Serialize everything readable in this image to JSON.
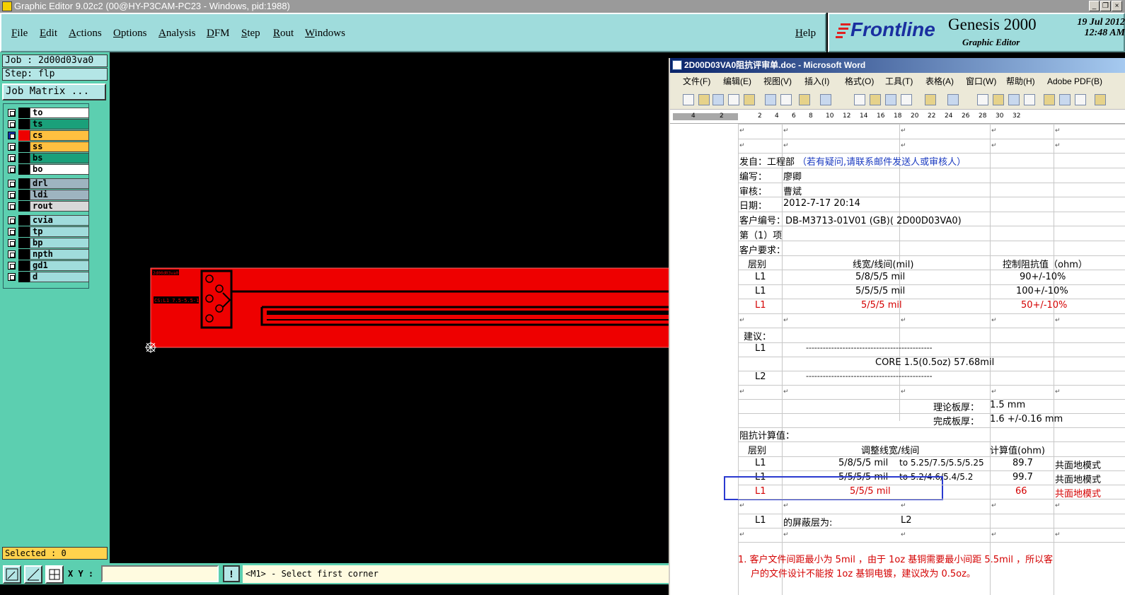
{
  "window": {
    "title": "Graphic Editor 9.02c2 (00@HY-P3CAM-PC23 - Windows, pid:1988)",
    "controls": [
      "_",
      "❐",
      "×"
    ]
  },
  "menu": {
    "items": [
      "File",
      "Edit",
      "Actions",
      "Options",
      "Analysis",
      "DFM",
      "Step",
      "Rout",
      "Windows"
    ],
    "help": "Help"
  },
  "brand": {
    "logo": "Frontline",
    "product": "Genesis 2000",
    "subtitle": "Graphic Editor",
    "date": "19 Jul 2012",
    "time": "12:48 AM"
  },
  "job": {
    "job": "Job : 2d00d03va0",
    "step": "Step: flp",
    "matrix_button": "Job Matrix ..."
  },
  "layers": [
    {
      "name": "to",
      "color": "#ffffff"
    },
    {
      "name": "ts",
      "color": "#1aa07a"
    },
    {
      "name": "cs",
      "color": "#ffc040",
      "active": true
    },
    {
      "name": "ss",
      "color": "#ffc040"
    },
    {
      "name": "bs",
      "color": "#1aa07a"
    },
    {
      "name": "bo",
      "color": "#ffffff"
    },
    {
      "name": "drl",
      "color": "#9eb4c0"
    },
    {
      "name": "ldi",
      "color": "#9eb4c0"
    },
    {
      "name": "rout",
      "color": "#d8d8d8"
    },
    {
      "name": "cvia",
      "color": "#a0dcdc"
    },
    {
      "name": "tp",
      "color": "#a0dcdc"
    },
    {
      "name": "bp",
      "color": "#a0dcdc"
    },
    {
      "name": "npth",
      "color": "#a0dcdc"
    },
    {
      "name": "gd1",
      "color": "#a0dcdc"
    },
    {
      "name": "d",
      "color": "#a0dcdc"
    }
  ],
  "selected": "Selected : 0",
  "xy_label": "X Y :",
  "warn": "!",
  "status": "<M1> - Select first corner",
  "board": {
    "label1": "2d00d03va0",
    "label2": "CS:L1 7.5-5.5-1.15"
  },
  "word": {
    "title": "2D00D03VA0阻抗评审单.doc - Microsoft Word",
    "menu": [
      "文件(F)",
      "编辑(E)",
      "视图(V)",
      "插入(I)",
      "格式(O)",
      "工具(T)",
      "表格(A)",
      "窗口(W)",
      "帮助(H)",
      "Adobe PDF(B)"
    ],
    "ruler": [
      "4",
      "2",
      "2",
      "4",
      "6",
      "8",
      "10",
      "12",
      "14",
      "16",
      "18",
      "20",
      "22",
      "24",
      "26",
      "28",
      "30",
      "32"
    ],
    "lines": {
      "from_label": "发自：工程部",
      "from_note": "（若有疑问,请联系邮件发送人或审核人）",
      "writer_label": "编写：",
      "writer": "廖卿",
      "reviewer_label": "审核：",
      "reviewer": "曹斌",
      "date_label": "日期：",
      "date": "2012-7-17 20:14",
      "customer": "客户编号：DB-M3713-01V01 (GB)( 2D00D03VA0)",
      "item": "第（1）项",
      "req": "客户要求：",
      "h_layer": "层别",
      "h_width": "线宽/线间(mil)",
      "h_imp": "控制阻抗值（ohm）",
      "r1_layer": "L1",
      "r1_width": "5/8/5/5 mil",
      "r1_imp": "90+/-10%",
      "r2_layer": "L1",
      "r2_width": "5/5/5/5 mil",
      "r2_imp": "100+/-10%",
      "r3_layer": "L1",
      "r3_width": "5/5/5 mil",
      "r3_imp": "50+/-10%",
      "suggest": "建议：",
      "s_l1": "L1",
      "dashes1": "---------------------------------------------",
      "core": "CORE  1.5(0.5oz)  57.68mil",
      "s_l2": "L2",
      "dashes2": "---------------------------------------------",
      "thick_label": "理论板厚：",
      "thick": "1.5 mm",
      "finish_label": "完成板厚：",
      "finish": "1.6 +/-0.16 mm",
      "calc": "阻抗计算值：",
      "c_layer": "层别",
      "c_width": "调整线宽/线间",
      "c_val": "计算值(ohm)",
      "c1_layer": "L1",
      "c1_width": "5/8/5/5 mil",
      "c1_to": "to 5.25/7.5/5.5/5.25",
      "c1_val": "89.7",
      "c1_mode": "共面地模式",
      "c2_layer": "L1",
      "c2_width": "5/5/5/5 mil",
      "c2_to": "to 5.2/4.6/5.4/5.2",
      "c2_val": "99.7",
      "c2_mode": "共面地模式",
      "c3_layer": "L1",
      "c3_width": "5/5/5 mil",
      "c3_val": "66",
      "c3_mode": "共面地模式",
      "shield_layer": "L1",
      "shield_label": "的屏蔽层为:",
      "shield_val": "L2",
      "note1": "1. 客户文件间距最小为 5mil ，由于 1oz 基铜需要最小间距 5.5mil ，所以客",
      "note2": "户的文件设计不能按 1oz 基铜电镀，建议改为 0.5oz。"
    }
  }
}
